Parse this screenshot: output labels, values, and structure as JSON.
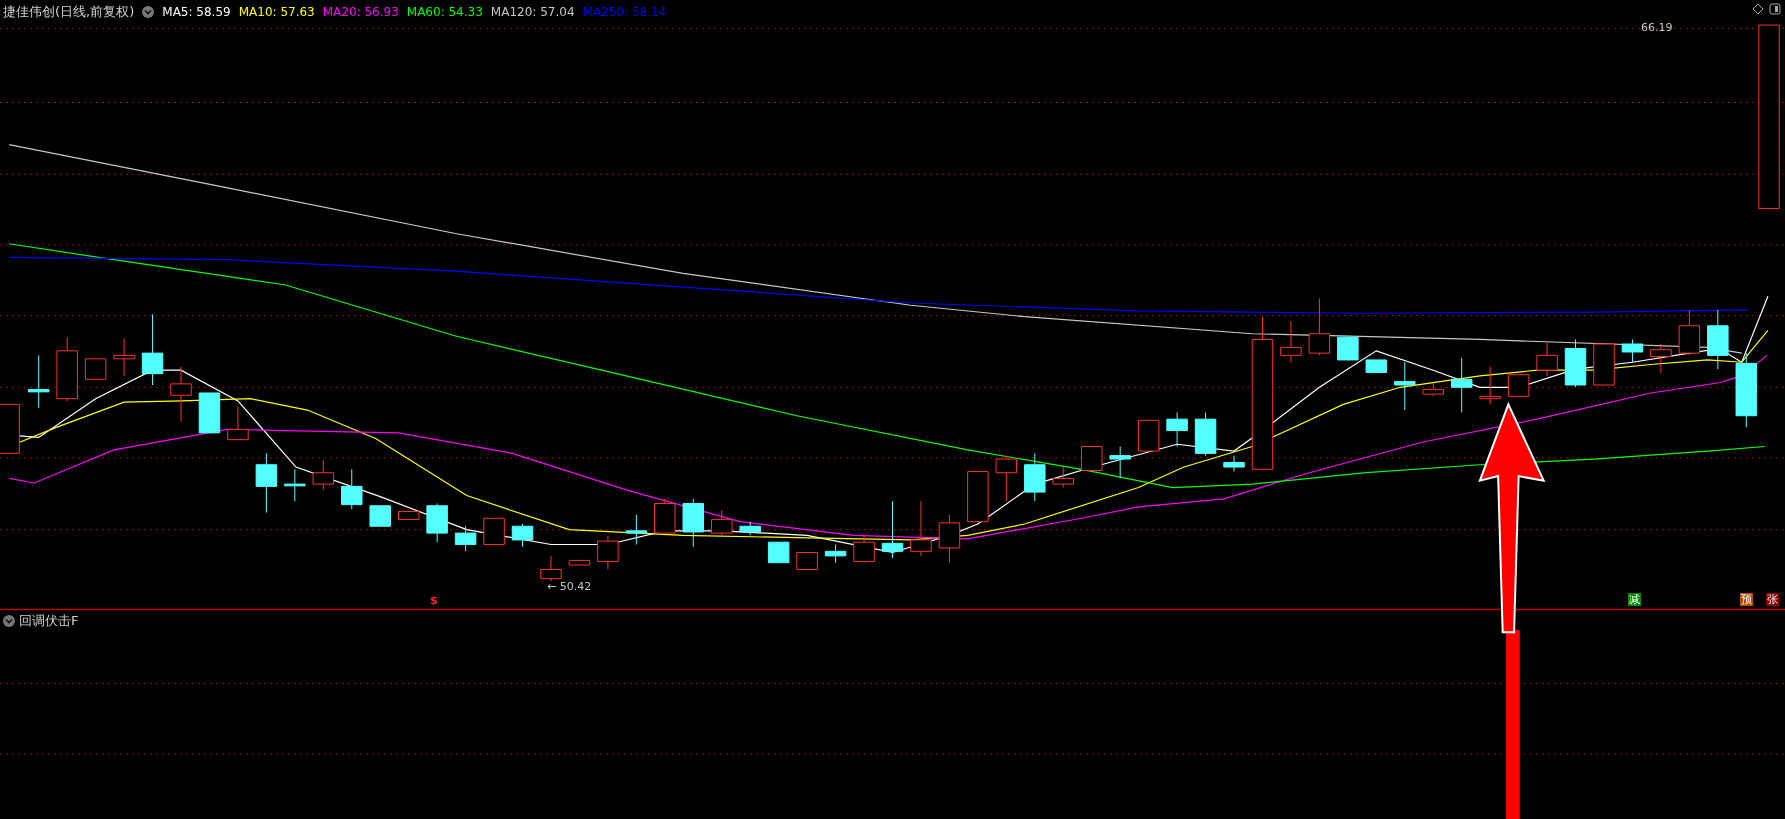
{
  "main_panel": {
    "title": "捷佳伟创(日线,前复权)",
    "moving_averages": [
      {
        "label": "MA5: 58.59",
        "color": "#ffffff"
      },
      {
        "label": "MA10: 57.63",
        "color": "#ffff00"
      },
      {
        "label": "MA20: 56.93",
        "color": "#ff00ff"
      },
      {
        "label": "MA60: 54.33",
        "color": "#00ff00"
      },
      {
        "label": "MA120: 57.04",
        "color": "#c8c8c8"
      },
      {
        "label": "MA250: 58.14",
        "color": "#0000ff"
      }
    ],
    "high_label": "66.19",
    "low_label": "← 50.42",
    "signal_mark": "$",
    "markers": [
      {
        "text": "减",
        "color": "#008a00"
      },
      {
        "text": "预",
        "color": "#b84a00"
      },
      {
        "text": "张",
        "color": "#8a0000"
      }
    ]
  },
  "indicator_panel": {
    "title": "回调伏击F"
  }
}
